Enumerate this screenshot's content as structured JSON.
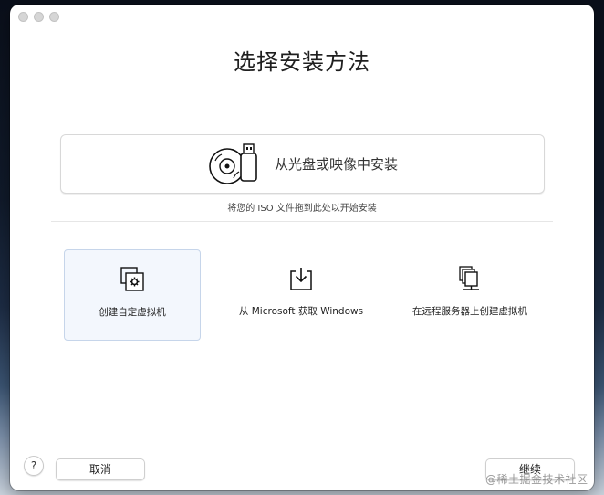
{
  "window": {
    "title": "选择安装方法"
  },
  "drop_zone": {
    "label": "从光盘或映像中安装",
    "icon": "disc-usb-icon"
  },
  "hint": "将您的 ISO 文件拖到此处以开始安装",
  "options": [
    {
      "label": "创建自定虚拟机",
      "icon": "custom-vm-icon",
      "selected": true
    },
    {
      "label": "从 Microsoft 获取 Windows",
      "icon": "download-icon",
      "selected": false
    },
    {
      "label": "在远程服务器上创建虚拟机",
      "icon": "remote-server-icon",
      "selected": false
    }
  ],
  "footer": {
    "help_label": "?",
    "cancel_label": "取消",
    "continue_label": "继续"
  },
  "watermark": "@稀土掘金技术社区",
  "colors": {
    "selected_background": "#f3f7fd",
    "selected_border": "#c6d5ea",
    "text": "#1f1f1f"
  }
}
